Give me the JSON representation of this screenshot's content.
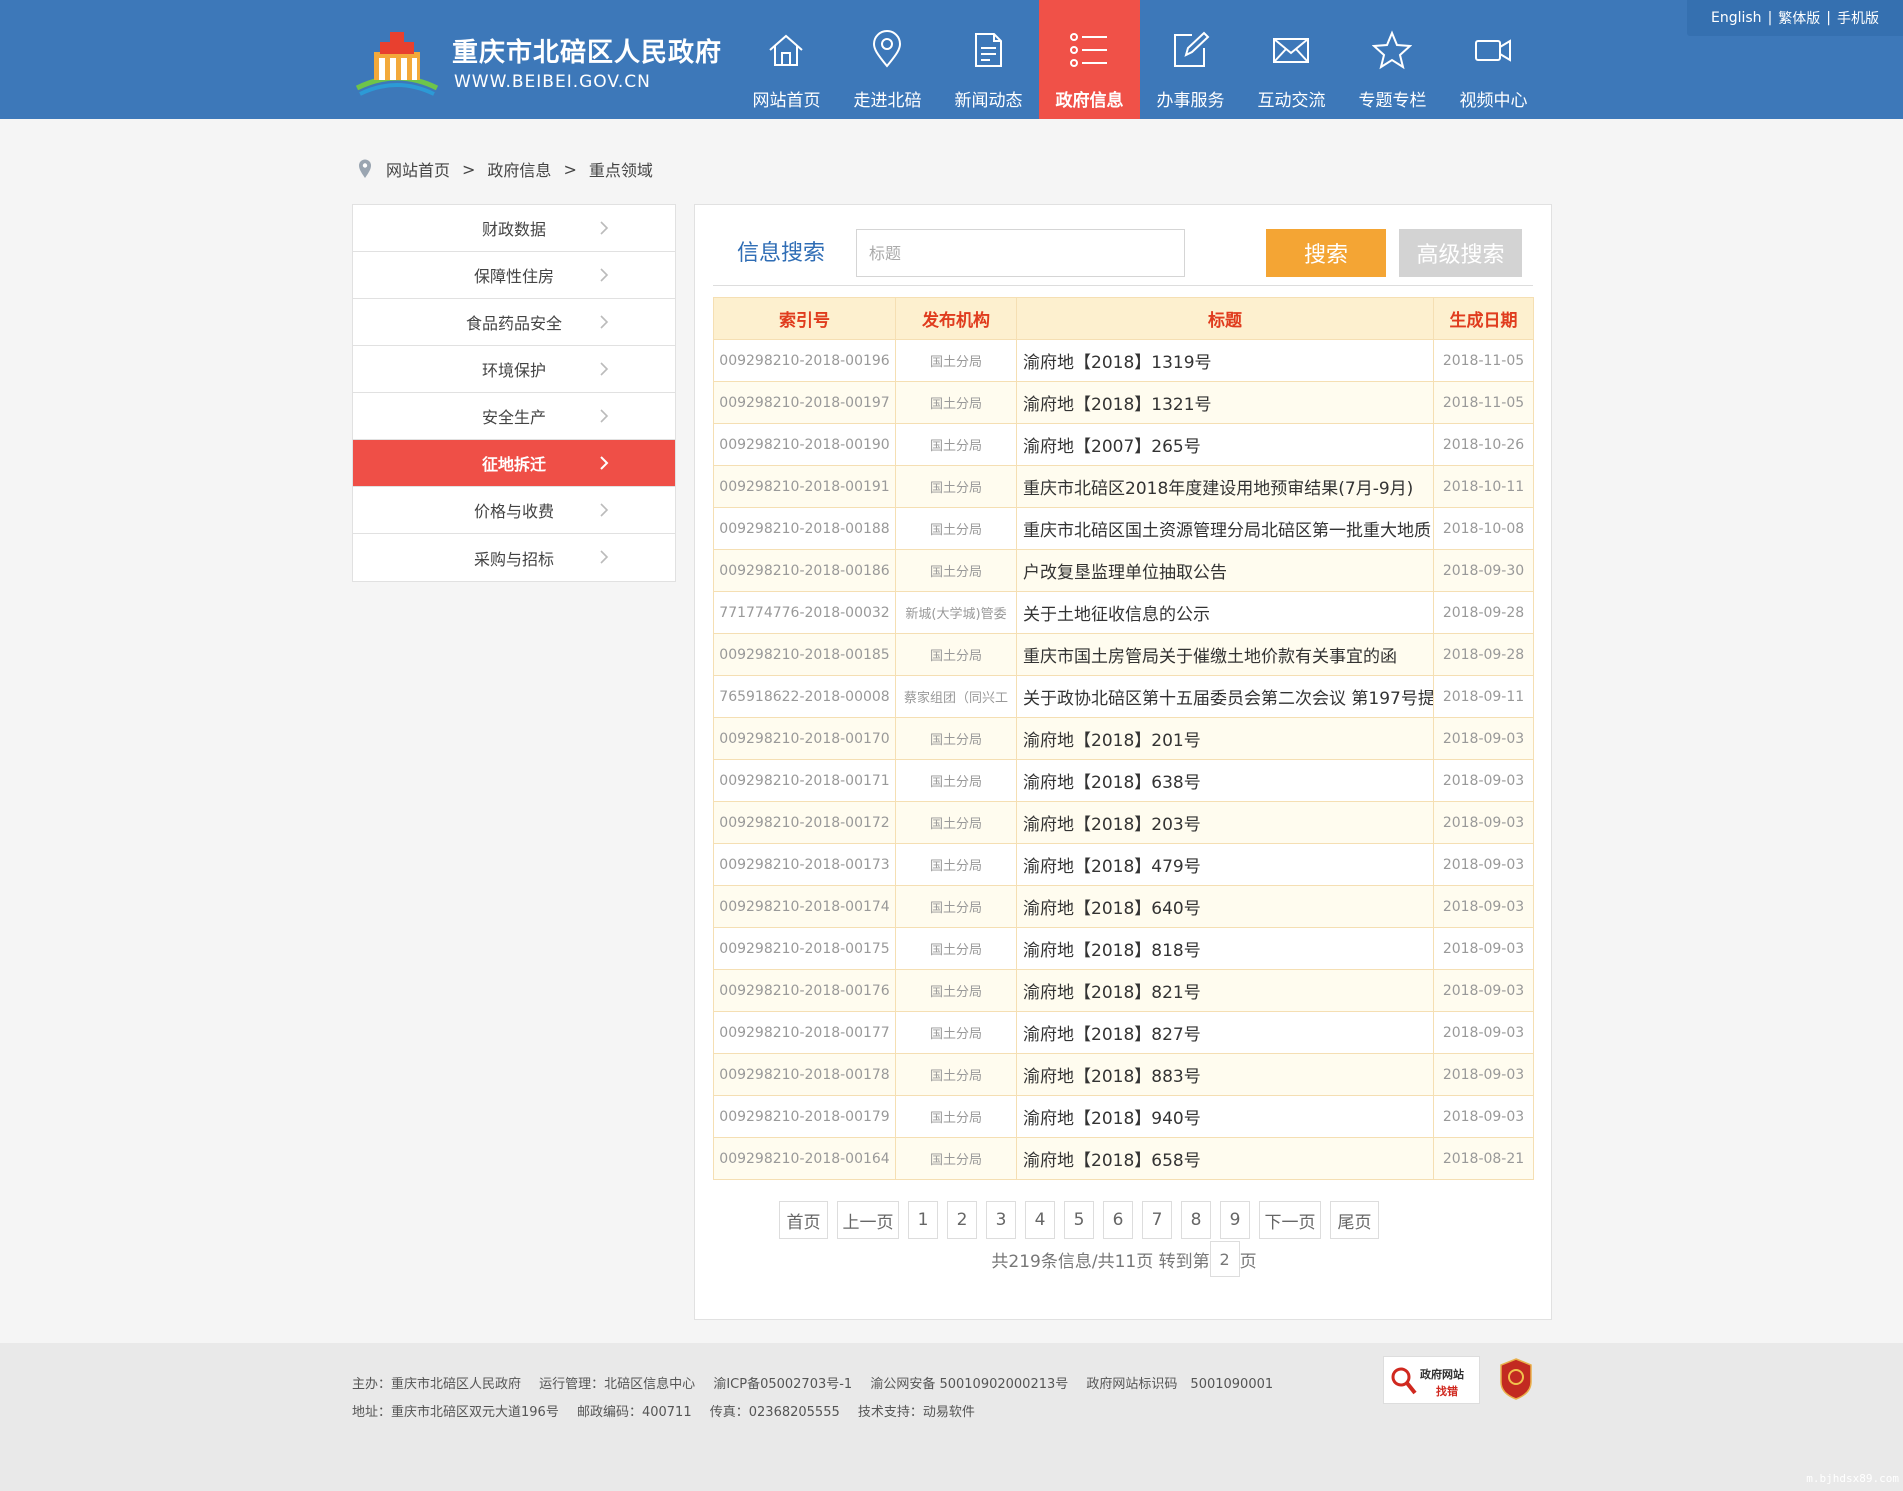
{
  "header": {
    "site_title": "重庆市北碚区人民政府",
    "site_url": "WWW.BEIBEI.GOV.CN",
    "top_links": [
      "English",
      "繁体版",
      "手机版"
    ],
    "nav": [
      {
        "label": "网站首页",
        "icon": "home-icon"
      },
      {
        "label": "走进北碚",
        "icon": "location-pin-icon"
      },
      {
        "label": "新闻动态",
        "icon": "document-icon"
      },
      {
        "label": "政府信息",
        "icon": "list-icon",
        "active": true
      },
      {
        "label": "办事服务",
        "icon": "edit-icon"
      },
      {
        "label": "互动交流",
        "icon": "mail-icon"
      },
      {
        "label": "专题专栏",
        "icon": "star-icon"
      },
      {
        "label": "视频中心",
        "icon": "video-camera-icon"
      }
    ],
    "colors": {
      "header_bg": "#3d78b9",
      "active_nav": "#f05148"
    }
  },
  "breadcrumb": [
    "网站首页",
    "政府信息",
    "重点领域"
  ],
  "breadcrumb_sep": ">",
  "sidebar": {
    "items": [
      {
        "label": "财政数据"
      },
      {
        "label": "保障性住房"
      },
      {
        "label": "食品药品安全"
      },
      {
        "label": "环境保护"
      },
      {
        "label": "安全生产"
      },
      {
        "label": "征地拆迁",
        "active": true
      },
      {
        "label": "价格与收费"
      },
      {
        "label": "采购与招标"
      }
    ]
  },
  "search": {
    "title": "信息搜索",
    "placeholder": "标题",
    "search_label": "搜索",
    "advanced_label": "高级搜索"
  },
  "table": {
    "headers": [
      "索引号",
      "发布机构",
      "标题",
      "生成日期"
    ],
    "rows": [
      {
        "index": "009298210-2018-00196",
        "org": "国土分局",
        "title": "渝府地【2018】1319号",
        "date": "2018-11-05"
      },
      {
        "index": "009298210-2018-00197",
        "org": "国土分局",
        "title": "渝府地【2018】1321号",
        "date": "2018-11-05"
      },
      {
        "index": "009298210-2018-00190",
        "org": "国土分局",
        "title": "渝府地【2007】265号",
        "date": "2018-10-26"
      },
      {
        "index": "009298210-2018-00191",
        "org": "国土分局",
        "title": "重庆市北碚区2018年度建设用地预审结果(7月-9月)",
        "date": "2018-10-11"
      },
      {
        "index": "009298210-2018-00188",
        "org": "国土分局",
        "title": "重庆市北碚区国土资源管理分局北碚区第一批重大地质",
        "date": "2018-10-08"
      },
      {
        "index": "009298210-2018-00186",
        "org": "国土分局",
        "title": "户改复垦监理单位抽取公告",
        "date": "2018-09-30"
      },
      {
        "index": "771774776-2018-00032",
        "org": "新城(大学城)管委",
        "title": "关于土地征收信息的公示",
        "date": "2018-09-28"
      },
      {
        "index": "009298210-2018-00185",
        "org": "国土分局",
        "title": "重庆市国土房管局关于催缴土地价款有关事宜的函",
        "date": "2018-09-28"
      },
      {
        "index": "765918622-2018-00008",
        "org": "蔡家组团（同兴工",
        "title": "关于政协北碚区第十五届委员会第二次会议 第197号提",
        "date": "2018-09-11"
      },
      {
        "index": "009298210-2018-00170",
        "org": "国土分局",
        "title": "渝府地【2018】201号",
        "date": "2018-09-03"
      },
      {
        "index": "009298210-2018-00171",
        "org": "国土分局",
        "title": "渝府地【2018】638号",
        "date": "2018-09-03"
      },
      {
        "index": "009298210-2018-00172",
        "org": "国土分局",
        "title": "渝府地【2018】203号",
        "date": "2018-09-03"
      },
      {
        "index": "009298210-2018-00173",
        "org": "国土分局",
        "title": "渝府地【2018】479号",
        "date": "2018-09-03"
      },
      {
        "index": "009298210-2018-00174",
        "org": "国土分局",
        "title": "渝府地【2018】640号",
        "date": "2018-09-03"
      },
      {
        "index": "009298210-2018-00175",
        "org": "国土分局",
        "title": "渝府地【2018】818号",
        "date": "2018-09-03"
      },
      {
        "index": "009298210-2018-00176",
        "org": "国土分局",
        "title": "渝府地【2018】821号",
        "date": "2018-09-03"
      },
      {
        "index": "009298210-2018-00177",
        "org": "国土分局",
        "title": "渝府地【2018】827号",
        "date": "2018-09-03"
      },
      {
        "index": "009298210-2018-00178",
        "org": "国土分局",
        "title": "渝府地【2018】883号",
        "date": "2018-09-03"
      },
      {
        "index": "009298210-2018-00179",
        "org": "国土分局",
        "title": "渝府地【2018】940号",
        "date": "2018-09-03"
      },
      {
        "index": "009298210-2018-00164",
        "org": "国土分局",
        "title": "渝府地【2018】658号",
        "date": "2018-08-21"
      }
    ]
  },
  "pagination": {
    "buttons": [
      "首页",
      "上一页",
      "1",
      "2",
      "3",
      "4",
      "5",
      "6",
      "7",
      "8",
      "9",
      "下一页",
      "尾页"
    ],
    "info_prefix": "共219条信息/共11页 转到第",
    "goto_value": "2",
    "info_suffix": "页"
  },
  "footer": {
    "line1": [
      "主办：重庆市北碚区人民政府",
      "运行管理：北碚区信息中心",
      "渝ICP备05002703号-1",
      "渝公网安备 50010902000213号",
      "政府网站标识码　5001090001"
    ],
    "line2": [
      "地址：重庆市北碚区双元大道196号",
      "邮政编码：400711",
      "传真：02368205555",
      "技术支持：动易软件"
    ],
    "badge_text1": "政府网站",
    "badge_text2": "找错"
  },
  "watermark": "m.bjhdsx89.com"
}
